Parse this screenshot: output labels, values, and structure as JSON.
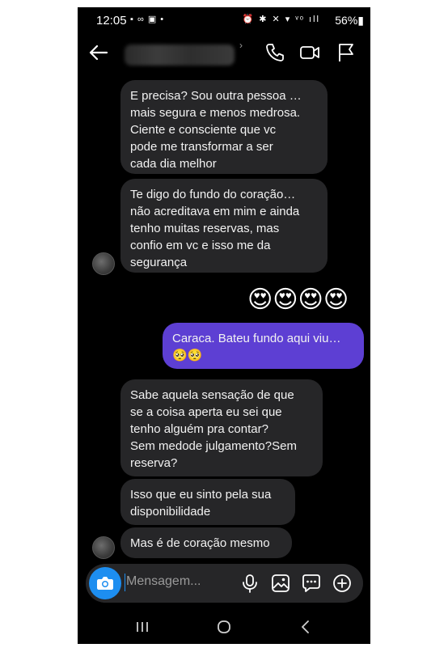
{
  "status_bar": {
    "time": "12:05",
    "left_icons": "▪ ∞ ▣ •",
    "right_icons": "⏰ ✱ ✕ ▾ ᵛᵒ ıll",
    "battery": "56%▮"
  },
  "header": {
    "contact_name": "",
    "chevron": "›"
  },
  "messages": [
    {
      "sender": "them",
      "text": "E precisa? Sou outra pessoa …\nmais segura e menos medrosa.\nCiente e consciente que vc\npode me transformar a ser\ncada dia melhor"
    },
    {
      "sender": "them",
      "text": "Te digo do fundo do coração…\nnão acreditava em mim e ainda\ntenho muitas reservas, mas\nconfio em vc e isso me da\nsegurança"
    },
    {
      "sender": "me",
      "text": "😍😍😍😍"
    },
    {
      "sender": "me",
      "text": "Caraca. Bateu fundo aqui viu…\n🥺🥺"
    },
    {
      "sender": "them",
      "text": "Sabe aquela sensação de que\nse a coisa aperta eu sei que\ntenho alguém pra contar?\nSem medode julgamento?Sem\nreserva?"
    },
    {
      "sender": "them",
      "text": "Isso que eu sinto pela sua\ndisponibilidade"
    },
    {
      "sender": "them",
      "text": "Mas é de coração mesmo"
    }
  ],
  "composer": {
    "placeholder": "Mensagem..."
  },
  "colors": {
    "background": "#000000",
    "incoming_bubble": "#262628",
    "outgoing_bubble": "#5d3fd3",
    "accent": "#1d8ef0"
  },
  "icons": {
    "header": [
      "back-arrow-icon",
      "phone-icon",
      "video-icon",
      "flag-icon"
    ],
    "composer": [
      "camera-icon",
      "microphone-icon",
      "image-icon",
      "sticker-icon",
      "plus-icon"
    ],
    "nav": [
      "recents-icon",
      "home-icon",
      "back-icon"
    ]
  }
}
